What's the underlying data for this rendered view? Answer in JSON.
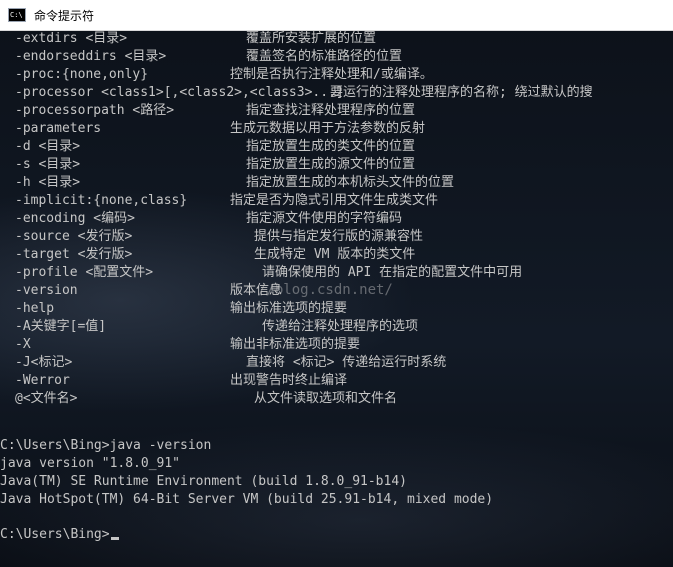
{
  "window": {
    "title": "命令提示符",
    "icon_label": "C:\\",
    "icon_name": "cmd-app-icon"
  },
  "options": [
    {
      "option": "-extdirs <目录>",
      "desc": "覆盖所安装扩展的位置"
    },
    {
      "option": "-endorseddirs <目录>",
      "desc": "覆盖签名的标准路径的位置"
    },
    {
      "option": "-proc:{none,only}",
      "desc": "控制是否执行注释处理和/或编译。"
    },
    {
      "option": "-processor <class1>[,<class2>,<class3>...]",
      "desc": "要运行的注释处理程序的名称; 绕过默认的搜"
    },
    {
      "option": "-processorpath <路径>",
      "desc": "指定查找注释处理程序的位置"
    },
    {
      "option": "-parameters",
      "desc": "生成元数据以用于方法参数的反射"
    },
    {
      "option": "-d <目录>",
      "desc": "指定放置生成的类文件的位置"
    },
    {
      "option": "-s <目录>",
      "desc": "指定放置生成的源文件的位置"
    },
    {
      "option": "-h <目录>",
      "desc": "指定放置生成的本机标头文件的位置"
    },
    {
      "option": "-implicit:{none,class}",
      "desc": "指定是否为隐式引用文件生成类文件"
    },
    {
      "option": "-encoding <编码>",
      "desc": "指定源文件使用的字符编码"
    },
    {
      "option": "-source <发行版>",
      "desc": "提供与指定发行版的源兼容性"
    },
    {
      "option": "-target <发行版>",
      "desc": "生成特定 VM 版本的类文件"
    },
    {
      "option": "-profile <配置文件>",
      "desc": "请确保使用的 API 在指定的配置文件中可用"
    },
    {
      "option": "-version",
      "desc": "版本信息"
    },
    {
      "option": "-help",
      "desc": "输出标准选项的提要"
    },
    {
      "option": "-A关键字[=值]",
      "desc": "传递给注释处理程序的选项"
    },
    {
      "option": "-X",
      "desc": "输出非标准选项的提要"
    },
    {
      "option": "-J<标记>",
      "desc": "直接将 <标记> 传递给运行时系统"
    },
    {
      "option": "-Werror",
      "desc": "出现警告时终止编译"
    },
    {
      "option": "@<文件名>",
      "desc": "从文件读取选项和文件名"
    }
  ],
  "session": [
    "C:\\Users\\Bing>java -version",
    "java version \"1.8.0_91\"",
    "Java(TM) SE Runtime Environment (build 1.8.0_91-b14)",
    "Java HotSpot(TM) 64-Bit Server VM (build 25.91-b14, mixed mode)"
  ],
  "prompt": "C:\\Users\\Bing>",
  "watermark": "//blog.csdn.net/",
  "colors": {
    "text": "#c6c6c6",
    "titlebar_bg": "#ffffff"
  }
}
